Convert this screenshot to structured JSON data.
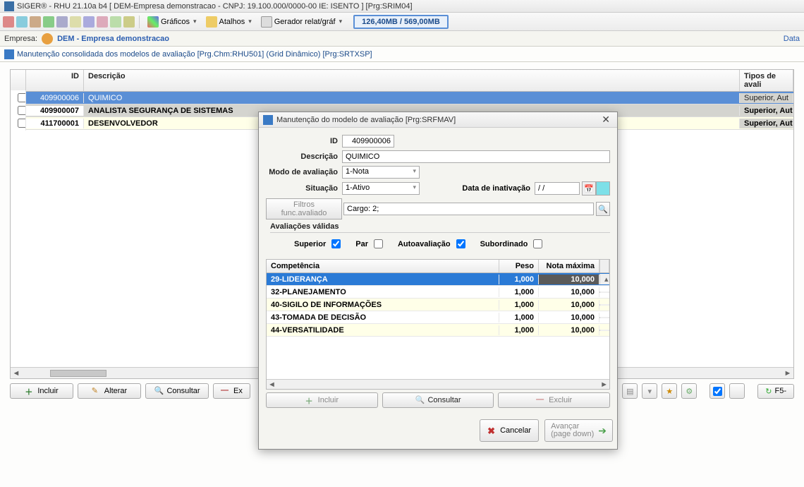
{
  "window": {
    "title": "SIGER® - RHU 21.10a b4 [ DEM-Empresa demonstracao - CNPJ: 19.100.000/0000-00 IE: ISENTO ] [Prg:SRIM04]"
  },
  "toolbar": {
    "graficos": "Gráficos",
    "atalhos": "Atalhos",
    "gerador": "Gerador relat/gráf",
    "memory": "126,40MB / 569,00MB"
  },
  "empresa": {
    "label": "Empresa:",
    "value": "DEM - Empresa demonstracao",
    "right": "Data"
  },
  "tab": {
    "title": "Manutenção consolidada dos modelos de avaliação [Prg.Chm:RHU501] (Grid Dinâmico) [Prg:SRTXSP]"
  },
  "grid": {
    "headers": {
      "id": "ID",
      "descricao": "Descrição",
      "tipos": "Tipos de avali"
    },
    "tipos_trunc": "Superior, Aut",
    "rows": [
      {
        "id": "409900006",
        "desc": "QUIMICO"
      },
      {
        "id": "409900007",
        "desc": "ANALISTA SEGURANÇA DE SISTEMAS"
      },
      {
        "id": "411700001",
        "desc": "DESENVOLVEDOR"
      }
    ]
  },
  "bottom": {
    "incluir": "Incluir",
    "alterar": "Alterar",
    "consultar": "Consultar",
    "excluir_short": "Ex",
    "f5": "F5-"
  },
  "modal": {
    "title": "Manutenção do modelo de avaliação [Prg:SRFMAV]",
    "labels": {
      "id": "ID",
      "descricao": "Descrição",
      "modo": "Modo de avaliação",
      "situacao": "Situação",
      "data_inat": "Data de inativação",
      "filtros": "Filtros func.avaliado",
      "avaliacoes": "Avaliações válidas",
      "superior": "Superior",
      "par": "Par",
      "autoavaliacao": "Autoavaliação",
      "subordinado": "Subordinado"
    },
    "values": {
      "id": "409900006",
      "descricao": "QUIMICO",
      "modo": "1-Nota",
      "situacao": "1-Ativo",
      "data_inat": "/ /",
      "filtros": "Cargo: 2;"
    },
    "checks": {
      "superior": true,
      "par": false,
      "autoavaliacao": true,
      "subordinado": false
    },
    "inner_grid": {
      "headers": {
        "comp": "Competência",
        "peso": "Peso",
        "nota": "Nota máxima"
      },
      "rows": [
        {
          "comp": "29-LIDERANÇA",
          "peso": "1,000",
          "nota": "10,000"
        },
        {
          "comp": "32-PLANEJAMENTO",
          "peso": "1,000",
          "nota": "10,000"
        },
        {
          "comp": "40-SIGILO DE INFORMAÇÕES",
          "peso": "1,000",
          "nota": "10,000"
        },
        {
          "comp": "43-TOMADA DE DECISÃO",
          "peso": "1,000",
          "nota": "10,000"
        },
        {
          "comp": "44-VERSATILIDADE",
          "peso": "1,000",
          "nota": "10,000"
        }
      ]
    },
    "buttons": {
      "incluir": "Incluir",
      "consultar": "Consultar",
      "excluir": "Excluir",
      "cancelar": "Cancelar",
      "avancar1": "Avançar",
      "avancar2": "(page down)"
    }
  }
}
